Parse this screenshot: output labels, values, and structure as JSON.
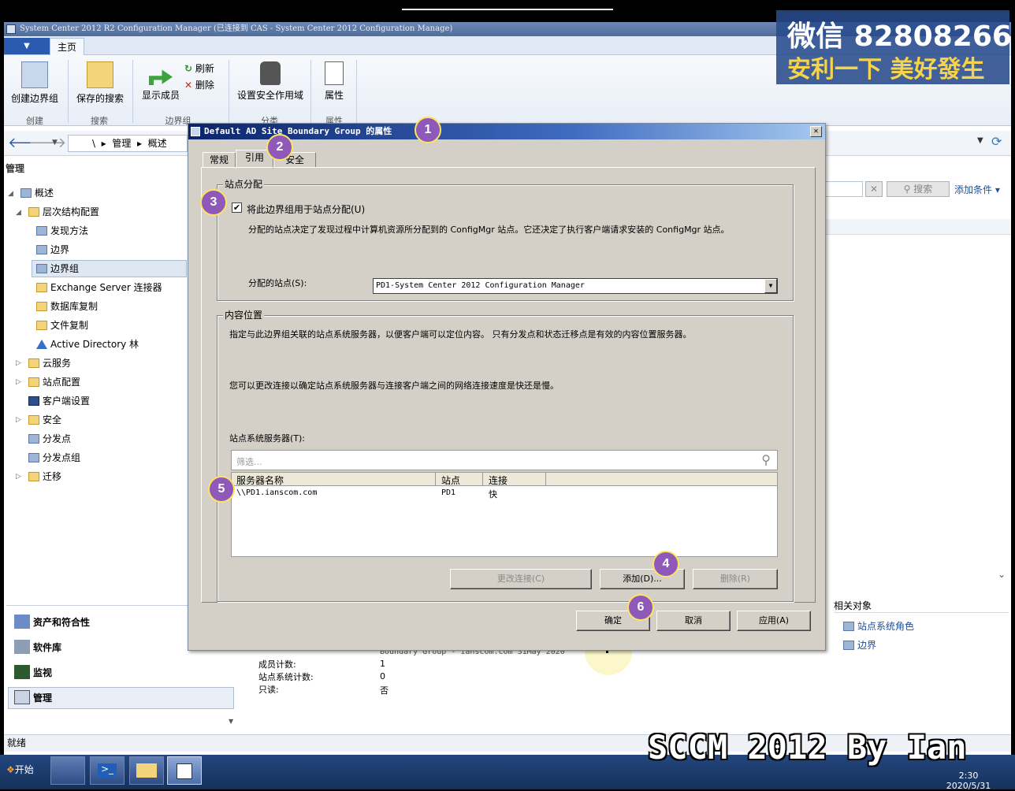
{
  "window": {
    "title": "System Center 2012 R2 Configuration Manager (已连接到 CAS - System Center 2012 Configuration Manage)"
  },
  "ribbon": {
    "home_tab": "主页",
    "create_boundary_group": "创建边界组",
    "saved_searches": "保存的搜索",
    "show_members": "显示成员",
    "refresh": "刷新",
    "delete": "删除",
    "set_security_scope": "设置安全作用域",
    "properties": "属性",
    "group_create": "创建",
    "group_search": "搜索",
    "group_boundary_group": "边界组",
    "group_classify": "分类",
    "group_properties": "属性"
  },
  "navbar": {
    "path_root": "\\",
    "path_manage": "管理",
    "path_overview": "概述"
  },
  "leftpane": {
    "title": "管理",
    "items": [
      {
        "label": "概述"
      },
      {
        "label": "层次结构配置"
      },
      {
        "label": "发现方法"
      },
      {
        "label": "边界"
      },
      {
        "label": "边界组"
      },
      {
        "label": "Exchange Server 连接器"
      },
      {
        "label": "数据库复制"
      },
      {
        "label": "文件复制"
      },
      {
        "label": "Active Directory 林"
      },
      {
        "label": "云服务"
      },
      {
        "label": "站点配置"
      },
      {
        "label": "客户端设置"
      },
      {
        "label": "安全"
      },
      {
        "label": "分发点"
      },
      {
        "label": "分发点组"
      },
      {
        "label": "迁移"
      }
    ]
  },
  "workspaces": {
    "assets": "资产和符合性",
    "software": "软件库",
    "monitoring": "监视",
    "admin": "管理"
  },
  "rightpane": {
    "search_button": "搜索",
    "add_criteria": "添加条件",
    "related_objects": "相关对象",
    "site_system_roles": "站点系统角色",
    "boundaries": "边界"
  },
  "detail": {
    "description_line": "Boundary Group - ianscom.com 31May 2020",
    "member_count_label": "成员计数:",
    "member_count_value": "1",
    "site_system_count_label": "站点系统计数:",
    "site_system_count_value": "0",
    "readonly_label": "只读:",
    "readonly_value": "否"
  },
  "status": {
    "text": "就绪"
  },
  "taskbar": {
    "start": "开始",
    "time": "2:30",
    "date": "2020/5/31"
  },
  "dialog": {
    "title": "Default AD Site Boundary Group 的属性",
    "tabs": [
      "常规",
      "引用",
      "安全"
    ],
    "site_assignment_group": "站点分配",
    "use_for_assignment": "将此边界组用于站点分配(U)",
    "assignment_desc": "分配的站点决定了发现过程中计算机资源所分配到的 ConfigMgr 站点。它还决定了执行客户端请求安装的 ConfigMgr 站点。",
    "assigned_site_label": "分配的站点(S):",
    "assigned_site_value": "PD1-System Center 2012 Configuration Manager",
    "content_location_group": "内容位置",
    "content_desc1": "指定与此边界组关联的站点系统服务器，以便客户端可以定位内容。  只有分发点和状态迁移点是有效的内容位置服务器。",
    "content_desc2": "您可以更改连接以确定站点系统服务器与连接客户端之间的网络连接速度是快还是慢。",
    "servers_label": "站点系统服务器(T):",
    "filter_placeholder": "筛选...",
    "columns": [
      "服务器名称",
      "站点",
      "连接"
    ],
    "rows": [
      {
        "server": "\\\\PD1.ianscom.com",
        "site": "PD1",
        "connection": "快"
      }
    ],
    "change_connection": "更改连接(C)",
    "add": "添加(D)...",
    "remove": "删除(R)",
    "ok": "确定",
    "cancel": "取消",
    "apply": "应用(A)"
  },
  "badges": [
    "1",
    "2",
    "3",
    "4",
    "5",
    "6"
  ],
  "overlay": {
    "wechat_line1": "微信 82808266",
    "wechat_line2": "安利一下 美好發生",
    "watermark": "SCCM 2012 By Ian"
  }
}
